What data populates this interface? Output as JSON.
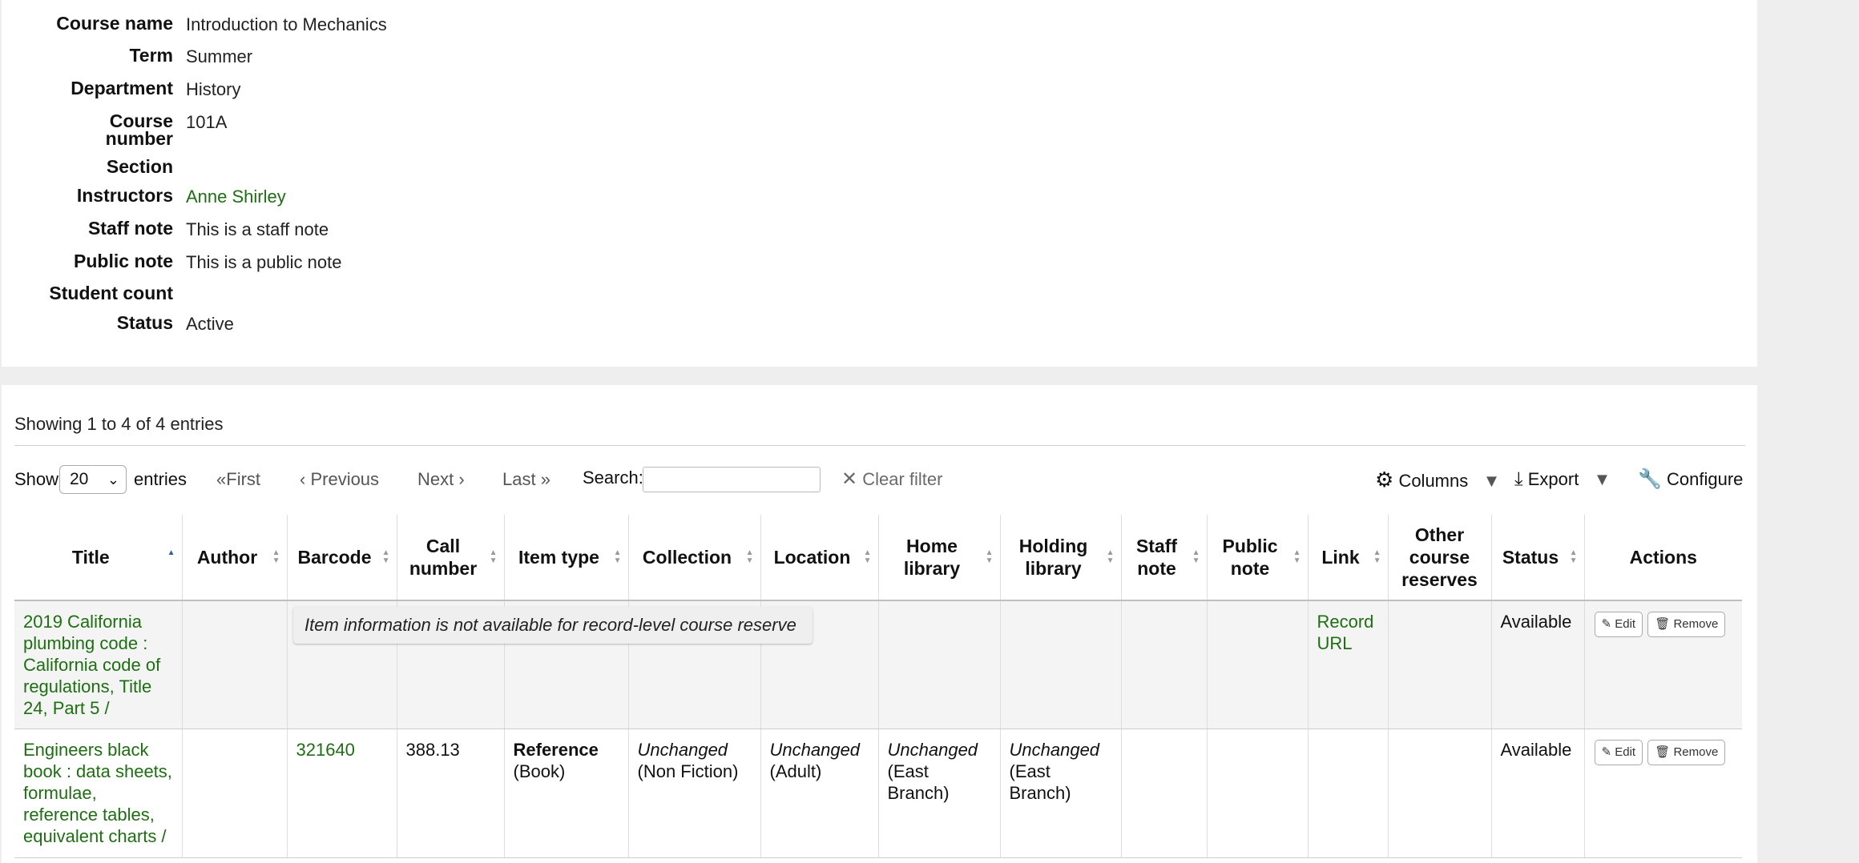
{
  "details": [
    {
      "label": "Course name",
      "value": "Introduction to Mechanics",
      "link": false
    },
    {
      "label": "Term",
      "value": "Summer",
      "link": false
    },
    {
      "label": "Department",
      "value": "History",
      "link": false
    },
    {
      "label": "Course number",
      "value": "101A",
      "link": false
    },
    {
      "label": "Section",
      "value": "",
      "link": false
    },
    {
      "label": "Instructors",
      "value": "Anne Shirley",
      "link": true
    },
    {
      "label": "Staff note",
      "value": "This is a staff note",
      "link": false
    },
    {
      "label": "Public note",
      "value": "This is a public note",
      "link": false
    },
    {
      "label": "Student count",
      "value": "",
      "link": false
    },
    {
      "label": "Status",
      "value": "Active",
      "link": false
    }
  ],
  "detail_label_lines": {
    "course_number_1": "Course",
    "course_number_2": "number"
  },
  "table_info": "Showing 1 to 4 of 4 entries",
  "toolbar": {
    "show_label": "Show",
    "entries_value": "20",
    "entries_label": "entries",
    "first": "First",
    "previous": "Previous",
    "next": "Next",
    "last": "Last",
    "search_label": "Search:",
    "search_value": "",
    "clear_filter": "Clear filter",
    "columns": "Columns",
    "export": "Export",
    "configure": "Configure"
  },
  "columns": {
    "title": "Title",
    "author": "Author",
    "barcode": "Barcode",
    "call_number_1": "Call",
    "call_number_2": "number",
    "item_type": "Item type",
    "collection": "Collection",
    "location": "Location",
    "home_library_1": "Home",
    "home_library_2": "library",
    "holding_library_1": "Holding",
    "holding_library_2": "library",
    "staff_note_1": "Staff",
    "staff_note_2": "note",
    "public_note_1": "Public",
    "public_note_2": "note",
    "link": "Link",
    "other_reserves_1": "Other",
    "other_reserves_2": "course",
    "other_reserves_3": "reserves",
    "status": "Status",
    "actions": "Actions"
  },
  "rows": [
    {
      "title": "2019 California plumbing code : California code of regulations, Title 24, Part 5 /",
      "tooltip": "Item information is not available for record-level course reserve",
      "link": "Record URL",
      "status": "Available",
      "edit": "Edit",
      "remove": "Remove"
    },
    {
      "title": "Engineers black book : data sheets, formulae, reference tables, equivalent charts /",
      "barcode": "321640",
      "call_number": "388.13",
      "item_type_main": "Reference",
      "item_type_sub": "(Book)",
      "collection_main": "Unchanged",
      "collection_sub": "(Non Fiction)",
      "location_main": "Unchanged",
      "location_sub": "(Adult)",
      "home_library_main": "Unchanged",
      "home_library_sub": "(East Branch)",
      "holding_library_main": "Unchanged",
      "holding_library_sub": "(East Branch)",
      "status": "Available",
      "edit": "Edit",
      "remove": "Remove"
    }
  ]
}
